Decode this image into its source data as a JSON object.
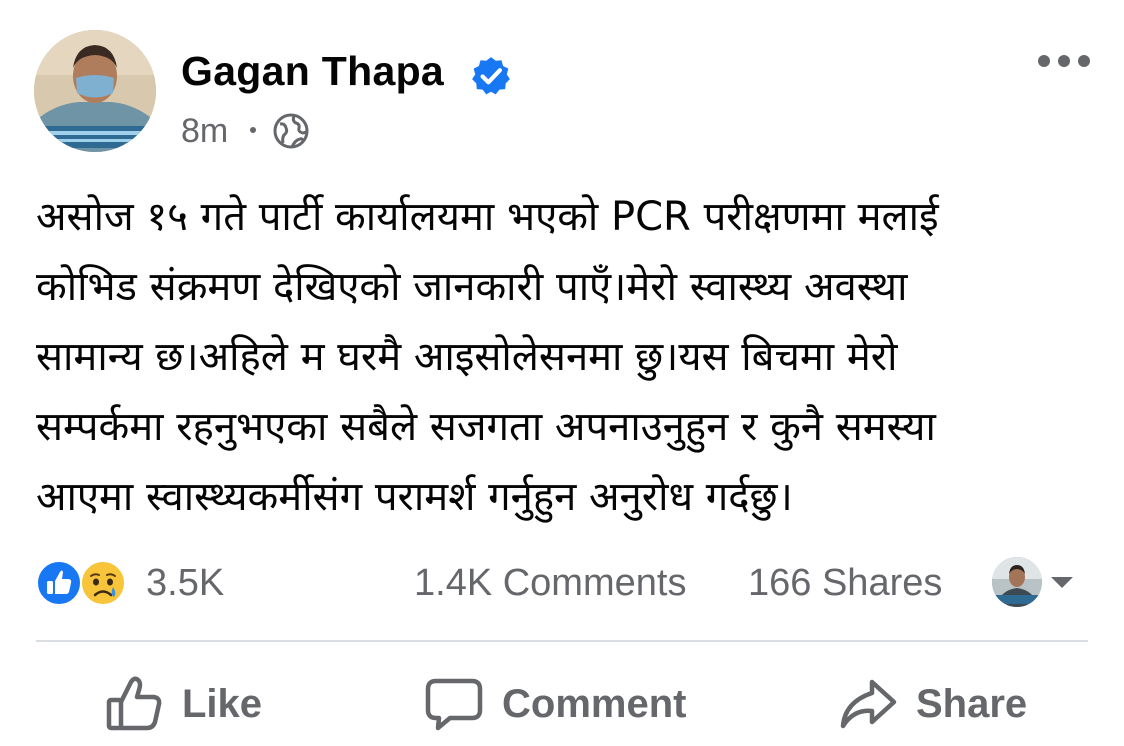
{
  "header": {
    "author_name": "Gagan Thapa",
    "verified": true,
    "time_ago": "8m",
    "audience_icon": "globe-icon",
    "more_icon": "more-options-icon"
  },
  "post": {
    "text_lines": [
      "असोज १५ गते पार्टी कार्यालयमा भएको PCR परीक्षणमा मलाई",
      "कोभिड संक्रमण देखिएको जानकारी पाएँ।मेरो स्वास्थ्य अवस्था",
      "सामान्य छ।अहिले म घरमै आइसोलेसनमा छु।यस बिचमा मेरो",
      "सम्पर्कमा रहनुभएका सबैले सजगता अपनाउनुहुन र कुनै समस्या",
      "आएमा स्वास्थ्यकर्मीसंग परामर्श गर्नुहुन अनुरोध गर्दछु।"
    ]
  },
  "engagement": {
    "reaction_icons": [
      "like-reaction-icon",
      "sad-reaction-icon"
    ],
    "reactions_count": "3.5K",
    "comments_label": "1.4K Comments",
    "shares_label": "166 Shares"
  },
  "actions": {
    "like_label": "Like",
    "comment_label": "Comment",
    "share_label": "Share"
  },
  "colors": {
    "text": "#050505",
    "secondary_text": "#65676b",
    "facebook_blue": "#1877f2",
    "divider": "#dadde1"
  }
}
